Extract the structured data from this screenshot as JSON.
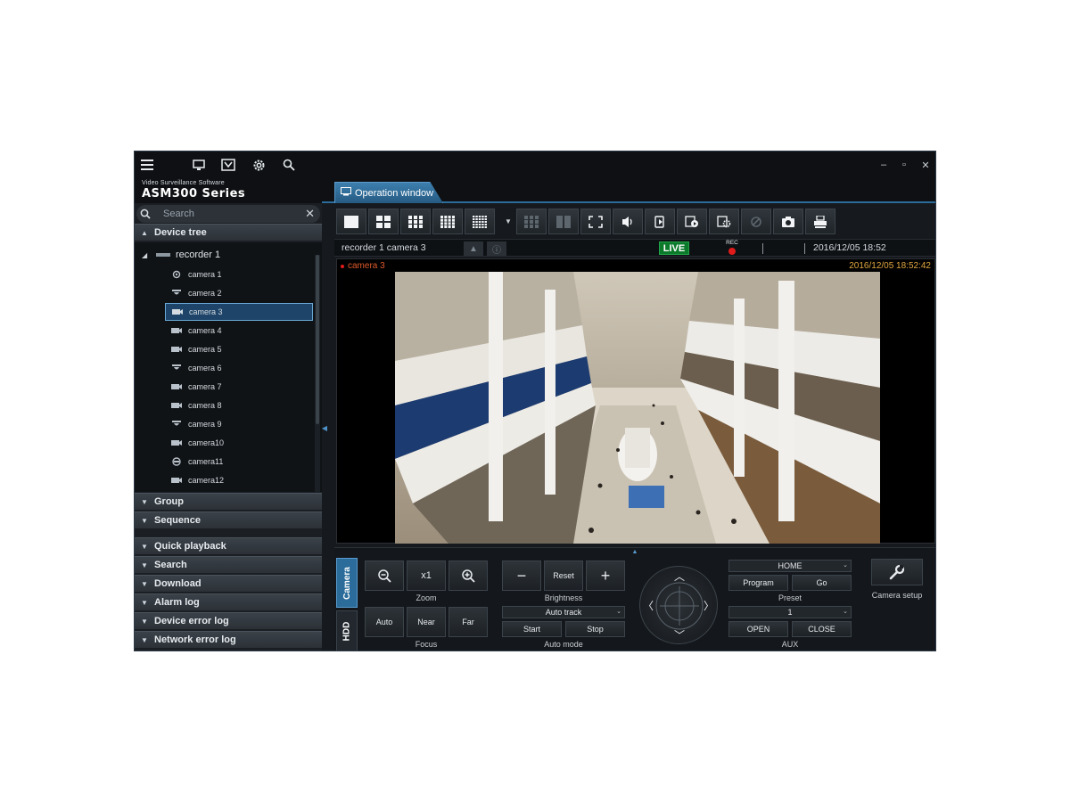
{
  "brand": {
    "subtitle": "Video Surveillance Software",
    "title": "ASM300 Series"
  },
  "topbar": {
    "icons": [
      "menu-icon",
      "monitor-icon",
      "map-icon",
      "settings-icon",
      "search-icon"
    ],
    "window_controls": [
      "minimize-icon",
      "maximize-icon",
      "close-icon"
    ]
  },
  "tab": {
    "label": "Operation window"
  },
  "left": {
    "search_placeholder": "Search",
    "sections": {
      "device_tree": "Device tree",
      "group": "Group",
      "sequence": "Sequence",
      "quick_playback": "Quick playback",
      "search": "Search",
      "download": "Download",
      "alarm_log": "Alarm log",
      "device_error_log": "Device error log",
      "network_error_log": "Network error log"
    },
    "recorder": "recorder 1",
    "cameras": [
      {
        "label": "camera 1",
        "icon": "ptz-camera-icon"
      },
      {
        "label": "camera 2",
        "icon": "dome-camera-icon"
      },
      {
        "label": "camera 3",
        "icon": "box-camera-icon",
        "selected": true
      },
      {
        "label": "camera 4",
        "icon": "box-camera-icon"
      },
      {
        "label": "camera 5",
        "icon": "box-camera-icon"
      },
      {
        "label": "camera 6",
        "icon": "dome-camera-icon"
      },
      {
        "label": "camera 7",
        "icon": "box-camera-icon"
      },
      {
        "label": "camera 8",
        "icon": "box-camera-icon"
      },
      {
        "label": "camera 9",
        "icon": "dome-camera-icon"
      },
      {
        "label": "camera10",
        "icon": "box-camera-icon"
      },
      {
        "label": "camera11",
        "icon": "fisheye-camera-icon"
      },
      {
        "label": "camera12",
        "icon": "box-camera-icon"
      }
    ]
  },
  "infobar": {
    "camera_name": "recorder 1 camera 3",
    "live": "LIVE",
    "rec": "REC",
    "timestamp": "2016/12/05 18:52"
  },
  "video": {
    "label": "camera 3",
    "timestamp": "2016/12/05 18:52:42"
  },
  "controls": {
    "tabs": [
      "Camera",
      "HDD"
    ],
    "zoom": {
      "x1": "x1",
      "label": "Zoom"
    },
    "focus": {
      "auto": "Auto",
      "near": "Near",
      "far": "Far",
      "label": "Focus"
    },
    "brightness": {
      "reset": "Reset",
      "label": "Brightness"
    },
    "auto_mode": {
      "value": "Auto track",
      "start": "Start",
      "stop": "Stop",
      "label": "Auto mode"
    },
    "preset": {
      "value": "HOME",
      "program": "Program",
      "go": "Go",
      "label": "Preset"
    },
    "aux": {
      "value": "1",
      "open": "OPEN",
      "close": "CLOSE",
      "label": "AUX"
    },
    "camera_setup": "Camera setup"
  },
  "colors": {
    "accent": "#3d7fae",
    "live_green": "#0b7a2b",
    "rec_red": "#e01b1b",
    "timestamp_orange": "#e0a640"
  }
}
